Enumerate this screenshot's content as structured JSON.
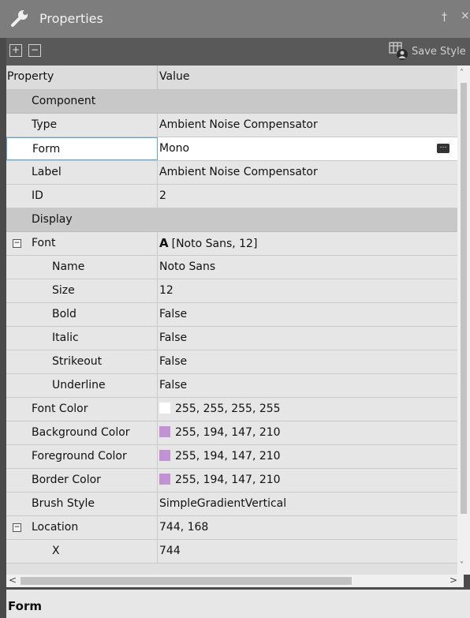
{
  "window": {
    "title": "Properties",
    "pin_glyph": "†",
    "close_glyph": "×"
  },
  "toolbar": {
    "expand_all": "+",
    "collapse_all": "−",
    "save_style_label": "Save Style"
  },
  "grid": {
    "header": {
      "property": "Property",
      "value": "Value"
    },
    "rows": [
      {
        "kind": "cat",
        "name": "Component"
      },
      {
        "kind": "prop",
        "name": "Type",
        "value": "Ambient Noise Compensator",
        "indent": 1
      },
      {
        "kind": "prop",
        "name": "Form",
        "value": "Mono",
        "indent": 1,
        "selected": true
      },
      {
        "kind": "prop",
        "name": "Label",
        "value": "Ambient Noise Compensator",
        "indent": 1
      },
      {
        "kind": "prop",
        "name": "ID",
        "value": "2",
        "indent": 1
      },
      {
        "kind": "cat",
        "name": "Display"
      },
      {
        "kind": "prop",
        "name": "Font",
        "value": "[Noto Sans, 12]",
        "prefix": "A",
        "indent": 1,
        "expander": "⊟"
      },
      {
        "kind": "prop",
        "name": "Name",
        "value": "Noto Sans",
        "indent": 2
      },
      {
        "kind": "prop",
        "name": "Size",
        "value": "12",
        "indent": 2
      },
      {
        "kind": "prop",
        "name": "Bold",
        "value": "False",
        "indent": 2
      },
      {
        "kind": "prop",
        "name": "Italic",
        "value": "False",
        "indent": 2
      },
      {
        "kind": "prop",
        "name": "Strikeout",
        "value": "False",
        "indent": 2
      },
      {
        "kind": "prop",
        "name": "Underline",
        "value": "False",
        "indent": 2
      },
      {
        "kind": "prop",
        "name": "Font Color",
        "value": "255, 255, 255, 255",
        "swatch": "#ffffff",
        "indent": 1
      },
      {
        "kind": "prop",
        "name": "Background Color",
        "value": "255, 194, 147, 210",
        "swatch": "#c293d2",
        "indent": 1
      },
      {
        "kind": "prop",
        "name": "Foreground Color",
        "value": "255, 194, 147, 210",
        "swatch": "#c293d2",
        "indent": 1
      },
      {
        "kind": "prop",
        "name": "Border Color",
        "value": "255, 194, 147, 210",
        "swatch": "#c293d2",
        "indent": 1
      },
      {
        "kind": "prop",
        "name": "Brush Style",
        "value": "SimpleGradientVertical",
        "indent": 1
      },
      {
        "kind": "prop",
        "name": "Location",
        "value": "744, 168",
        "indent": 1,
        "expander": "⊟"
      },
      {
        "kind": "prop",
        "name": "X",
        "value": "744",
        "indent": 2
      }
    ]
  },
  "scroll": {
    "up": "˄",
    "down": "˅",
    "left": "<",
    "right": ">"
  },
  "description": {
    "title": "Form"
  },
  "colors": {
    "titlebar": "#7d7d7d",
    "toolbar": "#595959",
    "category_row": "#c8c8c8",
    "selected_border": "#5aa6d6"
  }
}
